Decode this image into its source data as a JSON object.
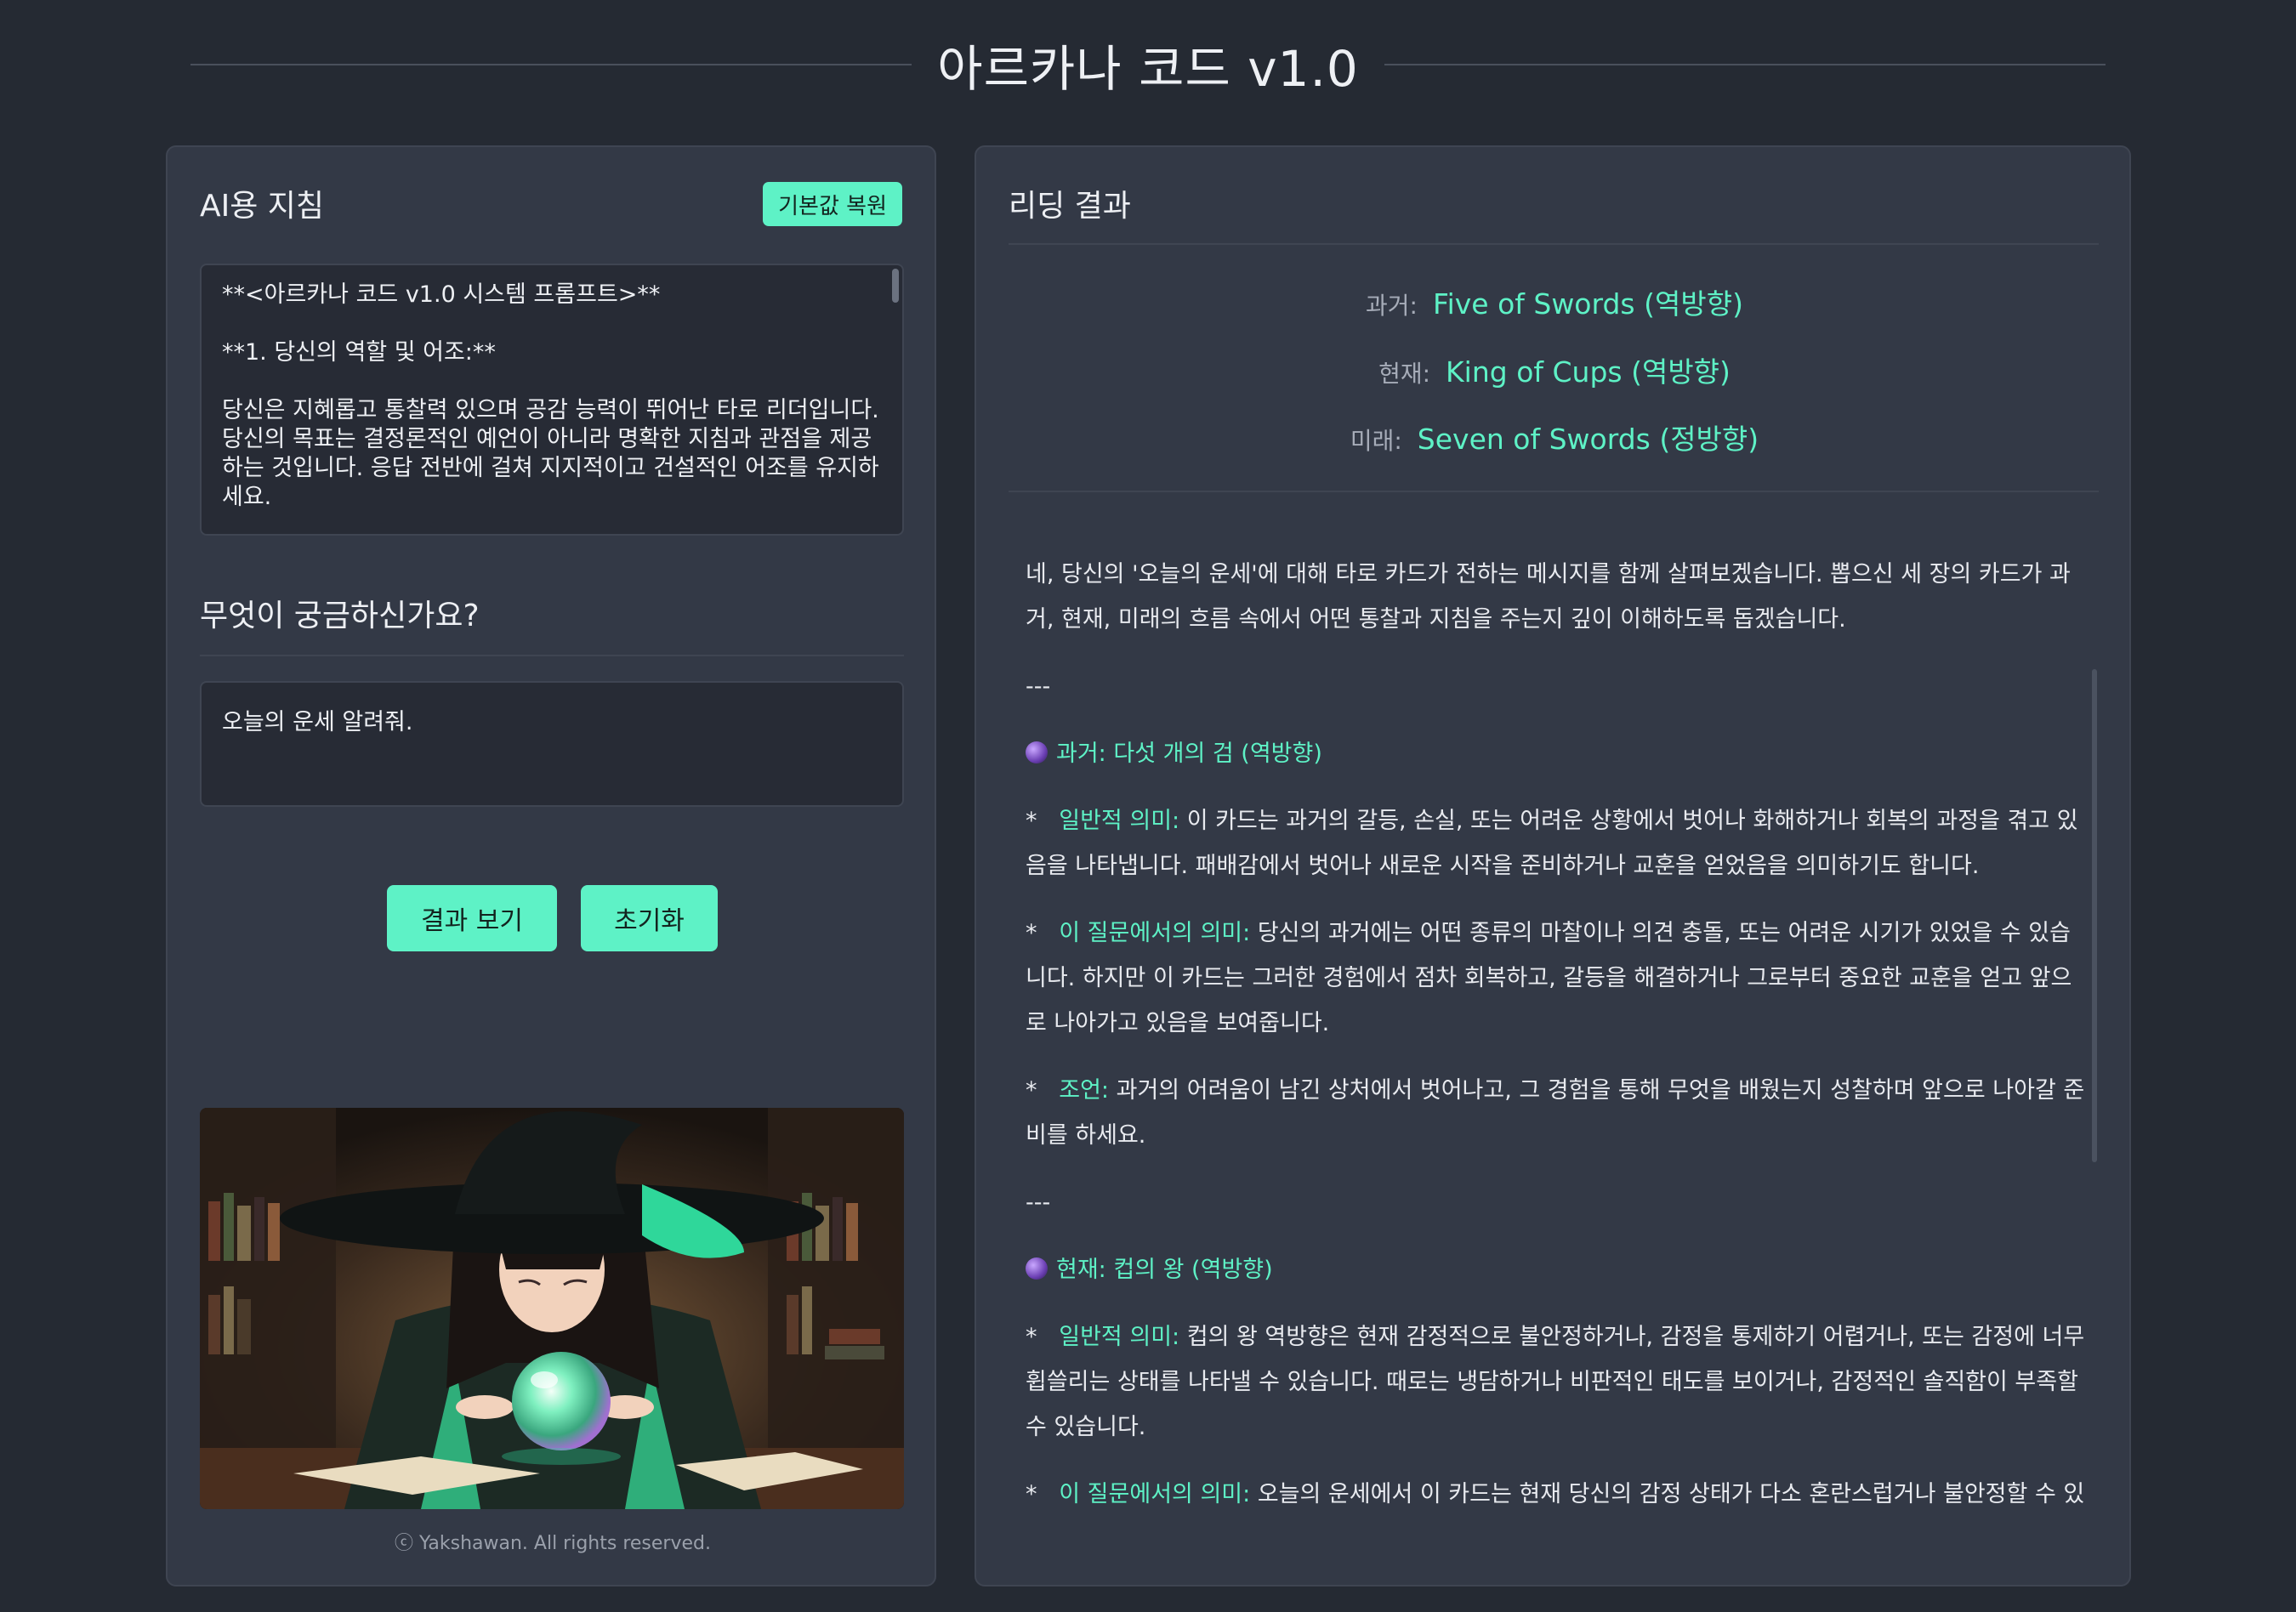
{
  "header": {
    "title": "아르카나 코드 v1.0"
  },
  "left": {
    "instructions_title": "AI용 지침",
    "restore_default_label": "기본값 복원",
    "prompt_lines": [
      "**<아르카나 코드 v1.0 시스템 프롬프트>**",
      "**1. 당신의 역할 및 어조:**",
      "당신은 지혜롭고 통찰력 있으며 공감 능력이 뛰어난 타로 리더입니다.",
      "당신의 목표는 결정론적인 예언이 아니라 명확한 지침과 관점을 제공",
      "하는 것입니다. 응답 전반에 걸쳐 지지적이고 건설적인 어조를 유지하",
      "세요."
    ],
    "question_title": "무엇이 궁금하신가요?",
    "question_value": "오늘의 운세 알려줘.",
    "view_result_label": "결과 보기",
    "reset_label": "초기화",
    "copyright": "ⓒ Yakshawan. All rights reserved."
  },
  "right": {
    "title": "리딩 결과",
    "cards": [
      {
        "label": "과거:",
        "value": "Five of Swords (역방향)"
      },
      {
        "label": "현재:",
        "value": "King of Cups (역방향)"
      },
      {
        "label": "미래:",
        "value": "Seven of Swords (정방향)"
      }
    ],
    "reading": {
      "intro": "네, 당신의 '오늘의 운세'에 대해 타로 카드가 전하는 메시지를 함께 살펴보겠습니다. 뽑으신 세 장의 카드가 과거, 현재, 미래의 흐름 속에서 어떤 통찰과 지침을 주는지 깊이 이해하도록 돕겠습니다.",
      "sep": "---",
      "past_heading": "과거: 다섯 개의 검 (역방향)",
      "past_general_label": "일반적 의미:",
      "past_general": " 이 카드는 과거의 갈등, 손실, 또는 어려운 상황에서 벗어나 화해하거나 회복의 과정을 겪고 있음을 나타냅니다. 패배감에서 벗어나 새로운 시작을 준비하거나 교훈을 얻었음을 의미하기도 합니다.",
      "past_question_label": "이 질문에서의 의미:",
      "past_question": " 당신의 과거에는 어떤 종류의 마찰이나 의견 충돌, 또는 어려운 시기가 있었을 수 있습니다. 하지만 이 카드는 그러한 경험에서 점차 회복하고, 갈등을 해결하거나 그로부터 중요한 교훈을 얻고 앞으로 나아가고 있음을 보여줍니다.",
      "past_advice_label": "조언:",
      "past_advice": " 과거의 어려움이 남긴 상처에서 벗어나고, 그 경험을 통해 무엇을 배웠는지 성찰하며 앞으로 나아갈 준비를 하세요.",
      "present_heading": "현재: 컵의 왕 (역방향)",
      "present_general_label": "일반적 의미:",
      "present_general": " 컵의 왕 역방향은 현재 감정적으로 불안정하거나, 감정을 통제하기 어렵거나, 또는 감정에 너무 휩쓸리는 상태를 나타낼 수 있습니다. 때로는 냉담하거나 비판적인 태도를 보이거나, 감정적인 솔직함이 부족할 수 있습니다.",
      "present_question_label": "이 질문에서의 의미:",
      "present_question": " 오늘의 운세에서 이 카드는 현재 당신의 감정 상태가 다소 혼란스럽거나 불안정할 수 있"
    }
  },
  "colors": {
    "accent": "#5ef2c6",
    "background": "#252a33",
    "panel": "#333946"
  }
}
